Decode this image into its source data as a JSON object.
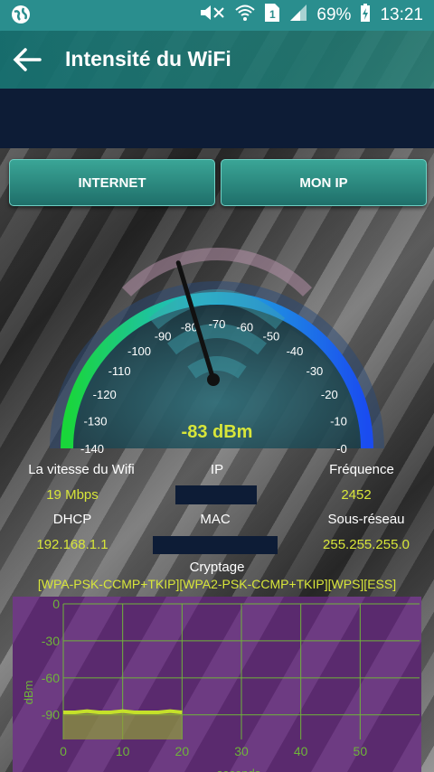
{
  "status_bar": {
    "battery": "69%",
    "time": "13:21"
  },
  "app_bar": {
    "title": "Intensité du WiFi"
  },
  "buttons": {
    "internet": "INTERNET",
    "mon_ip": "MON IP"
  },
  "gauge": {
    "reading": "-83 dBm",
    "value_dbm": -83,
    "ticks": [
      "-140",
      "-130",
      "-120",
      "-110",
      "-100",
      "-90",
      "-80",
      "-70",
      "-60",
      "-50",
      "-40",
      "-30",
      "-20",
      "-10",
      "-0"
    ]
  },
  "info": {
    "speed_label": "La vitesse du Wifi",
    "speed_value": "19 Mbps",
    "ip_label": "IP",
    "freq_label": "Fréquence",
    "freq_value": "2452",
    "dhcp_label": "DHCP",
    "dhcp_value": "192.168.1.1",
    "mac_label": "MAC",
    "subnet_label": "Sous-réseau",
    "subnet_value": "255.255.255.0",
    "crypto_label": "Cryptage",
    "crypto_value": "[WPA-PSK-CCMP+TKIP][WPA2-PSK-CCMP+TKIP][WPS][ESS]"
  },
  "graph": {
    "ylabel": "dBm",
    "xlabel": "seconds",
    "y_ticks": [
      "0",
      "-30",
      "-60",
      "-90"
    ],
    "x_ticks": [
      "0",
      "10",
      "20",
      "30",
      "40",
      "50"
    ],
    "series_x": [
      0,
      2,
      4,
      6,
      8,
      10,
      12,
      14,
      16,
      18,
      20
    ],
    "series_y": [
      -88,
      -88,
      -87,
      -88,
      -88,
      -87,
      -88,
      -88,
      -88,
      -87,
      -88
    ],
    "colors": {
      "line": "#c5e02a",
      "fill": "#8e9c3a",
      "bg": "#5a2a6e",
      "grid": "#6fb43a"
    }
  }
}
